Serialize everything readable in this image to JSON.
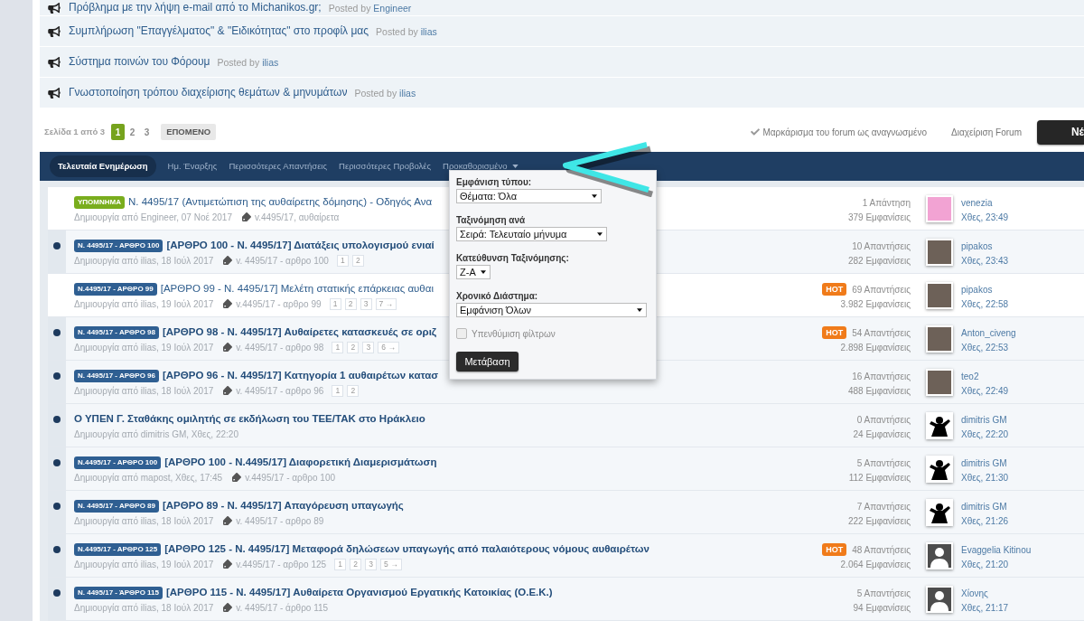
{
  "announcements": [
    {
      "title": "Πρόβλημα με την λήψη e-mail από το Michanikos.gr;",
      "posted_by": "Posted by",
      "author": "Engineer"
    },
    {
      "title": "Συμπλήρωση \"Επαγγέλματος\" & \"Ειδικότητας\" στο προφίλ μας",
      "posted_by": "Posted by",
      "author": "ilias"
    },
    {
      "title": "Σύστημα ποινών του Φόρουμ",
      "posted_by": "Posted by",
      "author": "ilias"
    },
    {
      "title": "Γνωστοποίηση τρόπου διαχείρισης θεμάτων & μηνυμάτων",
      "posted_by": "Posted by",
      "author": "ilias"
    }
  ],
  "pagination": {
    "label": "Σελίδα 1 από 3",
    "pages": [
      {
        "label": "1",
        "selected": true
      },
      {
        "label": "2",
        "selected": false
      },
      {
        "label": "3",
        "selected": false
      }
    ],
    "next": "ΕΠΟΜΕΝΟ"
  },
  "forum_actions": {
    "mark_read": "Μαρκάρισμα του forum ως αναγνωσμένο",
    "manage": "Διαχείριση Forum",
    "new_topic": "Νέ"
  },
  "sort_tabs": [
    {
      "label": "Τελευταία Ενημέρωση",
      "selected": true,
      "kind": "tab"
    },
    {
      "label": "Ημ. Έναρξης",
      "selected": false,
      "kind": "tab"
    },
    {
      "label": "Περισσότερες Απαντήσεις",
      "selected": false,
      "kind": "tab"
    },
    {
      "label": "Περισσότερες Προβολές",
      "selected": false,
      "kind": "tab"
    },
    {
      "label": "Προκαθορισμένο",
      "selected": false,
      "kind": "dropdown"
    }
  ],
  "filter_menu": {
    "fields": [
      {
        "label": "Εμφάνιση τύπου:",
        "value": "Θέματα: Όλα"
      },
      {
        "label": "Ταξινόμηση ανά",
        "value": "Σειρά: Τελευταίο μήνυμα"
      },
      {
        "label": "Κατεύθυνση Ταξινόμησης:",
        "value": "Z-A"
      },
      {
        "label": "Χρονικό Διάστημα:",
        "value": "Εμφάνιση Όλων"
      }
    ],
    "remember": {
      "label": "Υπενθύμιση φίλτρων",
      "checked": false
    },
    "submit": "Μετάβαση"
  },
  "topics": [
    {
      "unread": false,
      "prefix": {
        "text": "ΥΠΟΜΝΗΜΑ",
        "color": "#79ad1d"
      },
      "title": "Ν. 4495/17 (Αντιμετώπιση της αυθαίρετης δόμησης) - Οδηγός Ανα",
      "meta": "Δημιουργία από Engineer, 07 Νοέ 2017",
      "tags": "v.4495/17, αυθαίρετα",
      "replies": "1 Απάντηση",
      "views": "379 Εμφανίσεις",
      "avatar": {
        "kind": "cartoon"
      },
      "last_author": "venezia",
      "last_time": "Χθες, 23:49"
    },
    {
      "unread": true,
      "prefix": {
        "text": "Ν. 4495/17 - ΑΡΘΡΟ 100",
        "color": "#2f5f92"
      },
      "title": "[ΑΡΘΡΟ 100 - Ν. 4495/17] Διατάξεις υπολογισμού ενιαί",
      "meta": "Δημιουργία από ilias, 18 Ιούλ 2017",
      "tags": "v. 4495/17 - αρθρο 100",
      "pages": [
        "1",
        "2"
      ],
      "replies": "10 Απαντήσεις",
      "views": "282 Εμφανίσεις",
      "avatar": {
        "kind": "photo"
      },
      "last_author": "pipakos",
      "last_time": "Χθες, 23:43"
    },
    {
      "unread": false,
      "prefix": {
        "text": "Ν.4495/17 - ΑΡΘΡΟ 99",
        "color": "#2f5f92"
      },
      "title": "[ΑΡΘΡΟ 99 - Ν. 4495/17] Μελέτη στατικής επάρκειας αυθαι",
      "meta": "Δημιουργία από ilias, 19 Ιούλ 2017",
      "tags": "v.4495/17 - αρθρο 99",
      "pages": [
        "1",
        "2",
        "3",
        "7 →"
      ],
      "badge": "HOT",
      "replies": "69 Απαντήσεις",
      "views": "3.982 Εμφανίσεις",
      "avatar": {
        "kind": "photo"
      },
      "last_author": "pipakos",
      "last_time": "Χθες, 22:58"
    },
    {
      "unread": true,
      "prefix": {
        "text": "Ν. 4495/17 - ΑΡΘΡΟ 98",
        "color": "#2f5f92"
      },
      "title": "[ΑΡΘΡΟ 98 - Ν. 4495/17] Αυθαίρετες κατασκευές σε οριζ",
      "meta": "Δημιουργία από ilias, 19 Ιούλ 2017",
      "tags": "v. 4495/17 - αρθρο 98",
      "pages": [
        "1",
        "2",
        "3",
        "6 →"
      ],
      "badge": "HOT",
      "replies": "54 Απαντήσεις",
      "views": "2.898 Εμφανίσεις",
      "avatar": {
        "kind": "photo"
      },
      "last_author": "Anton_civeng",
      "last_time": "Χθες, 22:53"
    },
    {
      "unread": true,
      "prefix": {
        "text": "Ν. 4495/17 - ΑΡΘΡΟ 96",
        "color": "#2f5f92"
      },
      "title": "[ΑΡΘΡΟ 96 - Ν. 4495/17] Κατηγορία 1 αυθαιρέτων κατασ",
      "meta": "Δημιουργία από ilias, 18 Ιούλ 2017",
      "tags": "v. 4495/17 - αρθρο 96",
      "pages": [
        "1",
        "2"
      ],
      "replies": "16 Απαντήσεις",
      "views": "488 Εμφανίσεις",
      "avatar": {
        "kind": "photo"
      },
      "last_author": "teo2",
      "last_time": "Χθες, 22:49"
    },
    {
      "unread": true,
      "title": "Ο ΥΠΕΝ Γ. Σταθάκης ομιλητής σε εκδήλωση του ΤΕΕ/ΤΑΚ στο Ηράκλειο",
      "meta": "Δημιουργία από dimitris GM, Χθες, 22:20",
      "replies": "0 Απαντήσεις",
      "views": "24 Εμφανίσεις",
      "avatar": {
        "kind": "silhouette"
      },
      "last_author": "dimitris GM",
      "last_time": "Χθες, 22:20"
    },
    {
      "unread": true,
      "prefix": {
        "text": "Ν.4495/17 - ΑΡΘΡΟ 100",
        "color": "#2f5f92"
      },
      "title": "[ΑΡΘΡΟ 100 - Ν.4495/17] Διαφορετική Διαμερισμάτωση",
      "meta": "Δημιουργία από mapost, Χθες, 17:45",
      "tags": "v.4495/17 - αρθρο 100",
      "replies": "5 Απαντήσεις",
      "views": "112 Εμφανίσεις",
      "avatar": {
        "kind": "silhouette"
      },
      "last_author": "dimitris GM",
      "last_time": "Χθες, 21:30"
    },
    {
      "unread": true,
      "prefix": {
        "text": "Ν. 4495/17 - ΑΡΘΡΟ 89",
        "color": "#2f5f92"
      },
      "title": "[ΑΡΘΡΟ 89 - Ν. 4495/17] Απαγόρευση υπαγωγής",
      "meta": "Δημιουργία από ilias, 18 Ιούλ 2017",
      "tags": "v. 4495/17 - αρθρο 89",
      "replies": "7 Απαντήσεις",
      "views": "222 Εμφανίσεις",
      "avatar": {
        "kind": "silhouette"
      },
      "last_author": "dimitris GM",
      "last_time": "Χθες, 21:26"
    },
    {
      "unread": true,
      "prefix": {
        "text": "Ν.4495/17 - ΑΡΘΡΟ 125",
        "color": "#2f5f92"
      },
      "title": "[ΑΡΘΡΟ 125 - Ν. 4495/17] Μεταφορά δηλώσεων υπαγωγής από παλαιότερους νόμους αυθαιρέτων",
      "meta": "Δημιουργία από ilias, 19 Ιούλ 2017",
      "tags": "v.4495/17 - αρθρο 125",
      "pages": [
        "1",
        "2",
        "3",
        "5 →"
      ],
      "badge": "HOT",
      "replies": "48 Απαντήσεις",
      "views": "2.064 Εμφανίσεις",
      "avatar": {
        "kind": "default"
      },
      "last_author": "Evaggelia Kitinou",
      "last_time": "Χθες, 21:20"
    },
    {
      "unread": true,
      "prefix": {
        "text": "Ν. 4495/17 - ΆΡΘΡΟ 115",
        "color": "#2f5f92"
      },
      "title": "[ΑΡΘΡΟ 115 - Ν. 4495/17] Αυθαίρετα Οργανισμού Εργατικής Κατοικίας (Ο.Ε.Κ.)",
      "meta": "Δημιουργία από ilias, 18 Ιούλ 2017",
      "tags": "v. 4495/17 - άρθρο 115",
      "replies": "5 Απαντήσεις",
      "views": "94 Εμφανίσεις",
      "avatar": {
        "kind": "default"
      },
      "last_author": "Χίονης",
      "last_time": "Χθες, 21:17"
    }
  ]
}
